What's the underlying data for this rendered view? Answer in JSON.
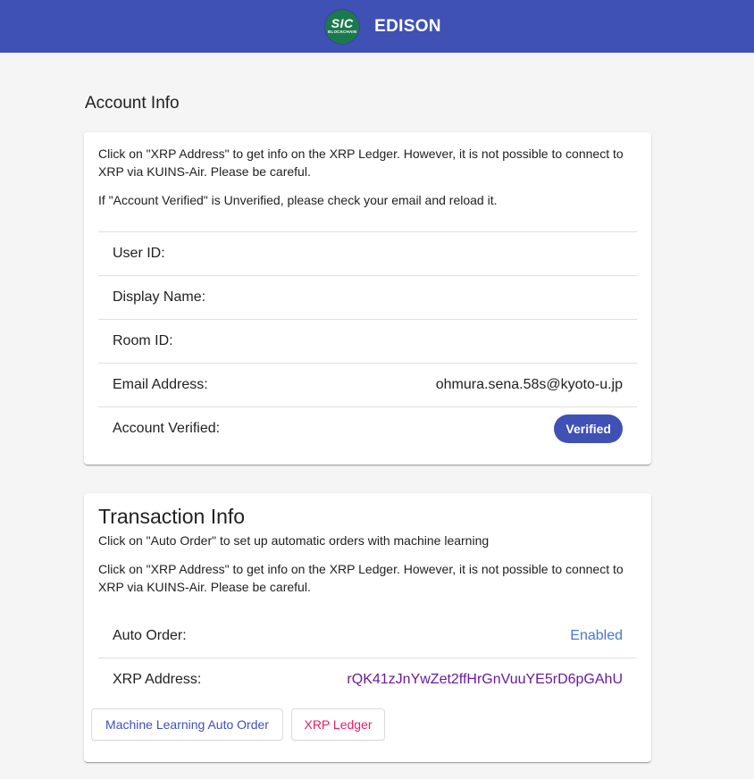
{
  "header": {
    "logo_main": "SIC",
    "logo_sub": "BLOCKCHAIN",
    "title": "EDISON"
  },
  "account": {
    "section_title": "Account Info",
    "note_xrp": "Click on \"XRP Address\" to get info on the XRP Ledger. However, it is not possible to connect to XRP via KUINS-Air. Please be careful.",
    "note_verified": "If \"Account Verified\" is Unverified, please check your email and reload it.",
    "rows": [
      {
        "label": "User ID:",
        "value": ""
      },
      {
        "label": "Display Name:",
        "value": ""
      },
      {
        "label": "Room ID:",
        "value": ""
      },
      {
        "label": "Email Address:",
        "value": "ohmura.sena.58s@kyoto-u.jp"
      },
      {
        "label": "Account Verified:",
        "value": "Verified"
      }
    ]
  },
  "transaction": {
    "title": "Transaction Info",
    "subtitle": "Click on \"Auto Order\" to set up automatic orders with machine learning",
    "note_xrp": "Click on \"XRP Address\" to get info on the XRP Ledger. However, it is not possible to connect to XRP via KUINS-Air. Please be careful.",
    "rows": [
      {
        "label": "Auto Order:",
        "value": "Enabled"
      },
      {
        "label": "XRP Address:",
        "value": "rQK41zJnYwZet2ffHrGnVuuYE5rD6pGAhU"
      }
    ],
    "buttons": {
      "ml_auto_order": "Machine Learning Auto Order",
      "xrp_ledger": "XRP Ledger"
    }
  },
  "colors": {
    "primary": "#3f51b5",
    "accent_pink": "#e91e63",
    "link_blue": "#4a77d4",
    "link_purple": "#6a1b9a",
    "logo_green": "#1b7a4d"
  }
}
